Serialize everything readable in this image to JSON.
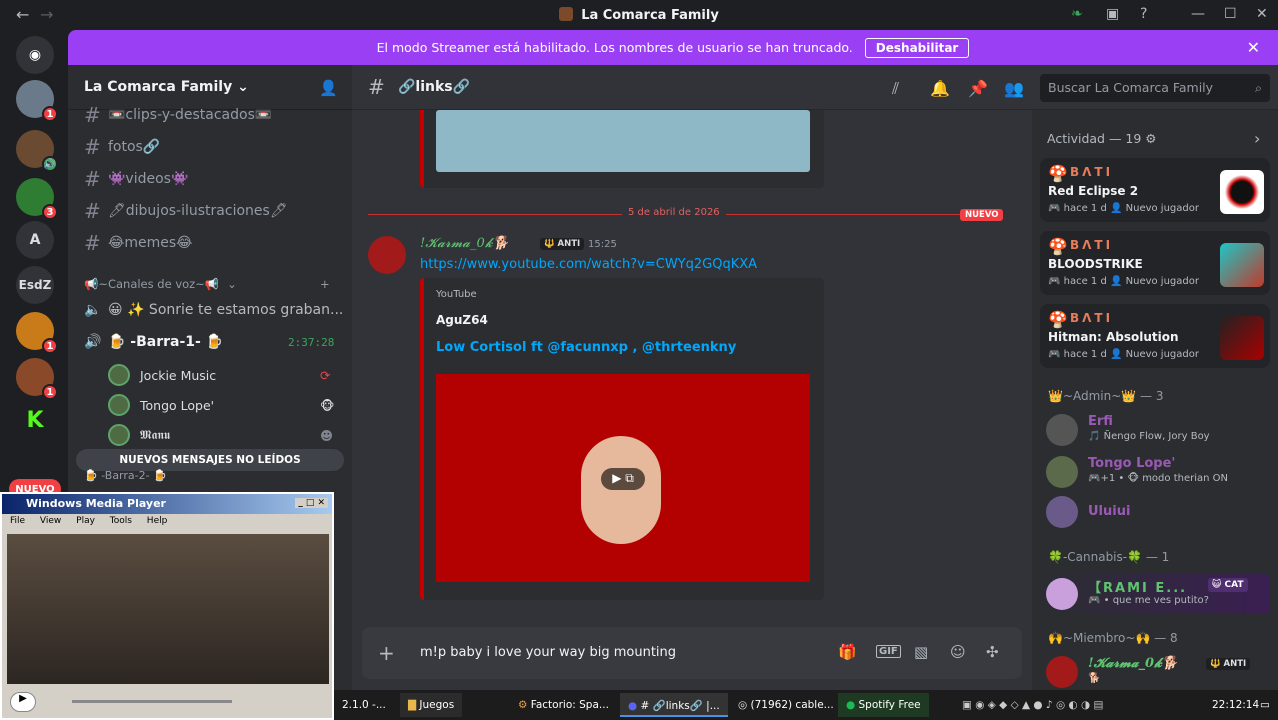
{
  "app": {
    "title": "La Comarca Family"
  },
  "banner": {
    "text": "El modo Streamer está habilitado. Los nombres de usuario se han truncado.",
    "button": "Deshabilitar"
  },
  "servers": {
    "items": [
      {
        "label": "A"
      },
      {
        "label": "EsdZ"
      },
      {
        "label": "K"
      }
    ],
    "badges": [
      "1",
      "1",
      "3",
      "1",
      "1",
      "1"
    ],
    "nuevo": "NUEVO"
  },
  "sidebar": {
    "guild_name": "La Comarca Family ⌄",
    "channels": [
      "📼clips-y-destacados📼",
      "fotos🔗",
      "👾videos👾",
      "🖊dibujos-ilustraciones🖊",
      "😂memes😂"
    ],
    "voice_category": "📢~Canales de voz~📢",
    "voice_channels": [
      "😀 ✨ Sonrie te estamos graban...",
      "🍺 -Barra-1- 🍺"
    ],
    "voice_timer": "2:37:28",
    "voice_users": [
      "Jockie Music",
      "Tongo Lope'",
      "𝕸𝖆𝖓𝖚"
    ],
    "unread": "NUEVOS MENSAJES NO LEÍDOS",
    "partial": "🍺 -Barra-2- 🍺"
  },
  "channel": {
    "name": "🔗links🔗",
    "search_placeholder": "Buscar La Comarca Family"
  },
  "chat": {
    "date_divider": "5 de abril de 2026",
    "new_tag": "NUEVO",
    "author": "!𝓚𝓪𝓻𝓶𝓪_0𝓴🐕",
    "author_tag": "🔱 ANTI",
    "time": "15:25",
    "link": "https://www.youtube.com/watch?v=CWYq2GQqKXA",
    "embed": {
      "provider": "YouTube",
      "author": "AguZ64",
      "title": "Low Cortisol ft @facunnxp , @thrteenkny"
    },
    "composer_text": "m!p baby i love your way big mounting"
  },
  "members": {
    "activity_header": "Actividad — 19 ⚙",
    "activities": [
      {
        "user": "BΛTI",
        "game": "Red Eclipse 2",
        "meta": "🎮 hace 1 d   👤 Nuevo jugador"
      },
      {
        "user": "BΛTI",
        "game": "BLOODSTRIKE",
        "meta": "🎮 hace 1 d   👤 Nuevo jugador"
      },
      {
        "user": "BΛTI",
        "game": "Hitman: Absolution",
        "meta": "🎮 hace 1 d   👤 Nuevo jugador"
      }
    ],
    "groups": [
      {
        "label": "👑~Admin~👑 — 3"
      },
      {
        "label": "🍀-Cannabis-🍀 — 1"
      },
      {
        "label": "🙌~Miembro~🙌 — 8"
      }
    ],
    "list": [
      {
        "name": "Erfi",
        "sub": "🎵 Ñengo Flow, Jory Boy",
        "color": "#9b59b6"
      },
      {
        "name": "Tongo Lope'",
        "sub": "🎮+1 • 🐵 modo therian ON",
        "color": "#9b59b6"
      },
      {
        "name": "Uluiui",
        "sub": "",
        "color": "#9b59b6"
      },
      {
        "name": "【RAMI E...",
        "sub": "🎮 • que me ves putito?",
        "color": "#5fc36f"
      },
      {
        "name": "!𝓚𝓪𝓻𝓶𝓪_0𝓴🐕",
        "sub": "🐕",
        "color": "#5fc36f"
      }
    ],
    "cat_tag": "😺 CAT",
    "anti_tag": "🔱 ANTI"
  },
  "wmp": {
    "title": "Windows Media Player",
    "menu": "File View Play Tools Help"
  },
  "taskbar": {
    "items": [
      "2.1.0 -...",
      "Juegos",
      "Factorio: Spa...",
      "# 🔗links🔗 |...",
      "(71962) cable...",
      "Spotify Free"
    ],
    "clock": "22:12:14"
  }
}
